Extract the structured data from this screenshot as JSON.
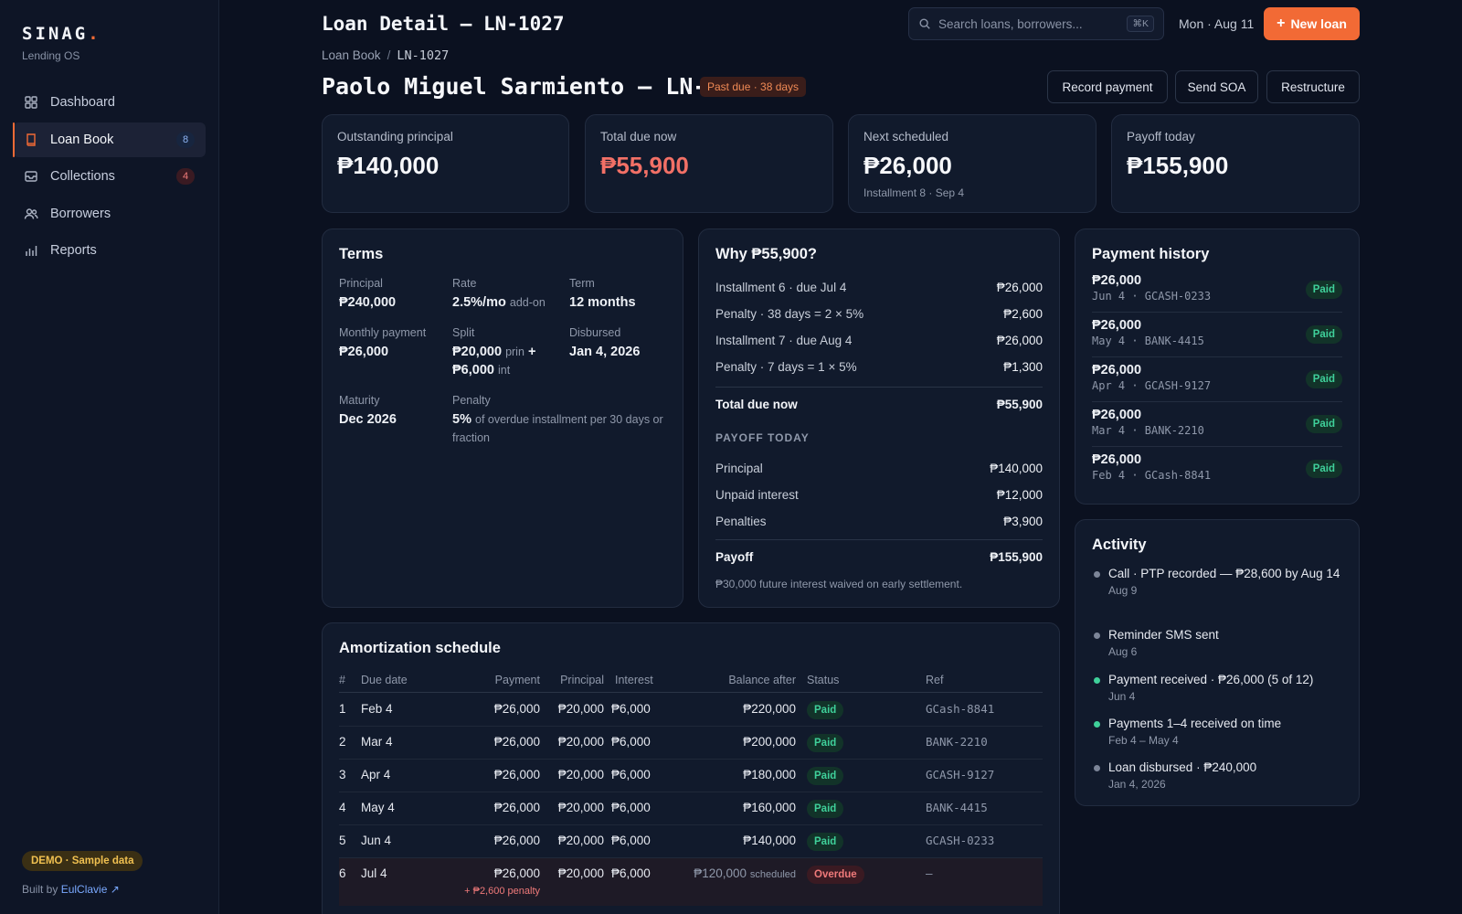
{
  "brand": {
    "name": "SINAG",
    "dot": ".",
    "sub": "Lending OS"
  },
  "nav": [
    {
      "label": "Dashboard",
      "icon": "grid-icon",
      "badge": ""
    },
    {
      "label": "Loan Book",
      "icon": "book-icon",
      "badge": "8"
    },
    {
      "label": "Collections",
      "icon": "inbox-icon",
      "badge": "4"
    },
    {
      "label": "Borrowers",
      "icon": "users-icon",
      "badge": ""
    },
    {
      "label": "Reports",
      "icon": "bar-chart-icon",
      "badge": ""
    }
  ],
  "footer": {
    "demo": "DEMO · Sample data",
    "built_by": "Built by",
    "author": "EulClavie ↗"
  },
  "header": {
    "title": "Loan Detail — LN-1027",
    "search_placeholder": "Search loans, borrowers...",
    "search_kbd": "⌘K",
    "date": "Mon · Aug 11",
    "new_loan": "New loan",
    "new_loan_plus": "+"
  },
  "breadcrumb": {
    "root": "Loan Book",
    "sep": "/",
    "current": "LN-1027"
  },
  "loan": {
    "title": "Paolo Miguel Sarmiento — LN-1027",
    "status": "Past due · 38 days",
    "actions": [
      "Record payment",
      "Send SOA",
      "Restructure"
    ]
  },
  "kpis": [
    {
      "label": "Outstanding principal",
      "value": "₱140,000",
      "sub": ""
    },
    {
      "label": "Total due now",
      "value": "₱55,900",
      "sub": ""
    },
    {
      "label": "Next scheduled",
      "value": "₱26,000",
      "sub": "Installment 8 · Sep 4"
    },
    {
      "label": "Payoff today",
      "value": "₱155,900",
      "sub": ""
    }
  ],
  "terms": {
    "title": "Terms",
    "principal_label": "Principal",
    "principal": "₱240,000",
    "rate_label": "Rate",
    "rate": "2.5%/mo",
    "rate_note": "add-on",
    "term_label": "Term",
    "term": "12 months",
    "monthly_label": "Monthly payment",
    "monthly": "₱26,000",
    "split_label": "Split",
    "split_prin": "₱20,000",
    "split_prin_note": "prin",
    "split_plus": "+",
    "split_int": "₱6,000",
    "split_int_note": "int",
    "disbursed_label": "Disbursed",
    "disbursed": "Jan 4, 2026",
    "maturity_label": "Maturity",
    "maturity": "Dec 2026",
    "penalty_label": "Penalty",
    "penalty": "5%",
    "penalty_note": "of overdue installment per 30 days or fraction"
  },
  "why": {
    "title": "Why ₱55,900?",
    "rows": [
      {
        "label": "Installment 6 · due Jul 4",
        "amount": "₱26,000"
      },
      {
        "label": "Penalty · 38 days = 2 × 5%",
        "amount": "₱2,600"
      },
      {
        "label": "Installment 7 · due Aug 4",
        "amount": "₱26,000"
      },
      {
        "label": "Penalty · 7 days = 1 × 5%",
        "amount": "₱1,300"
      }
    ],
    "total_label": "Total due now",
    "total": "₱55,900",
    "payoff_section": "PAYOFF TODAY",
    "payoff_rows": [
      {
        "label": "Principal",
        "amount": "₱140,000"
      },
      {
        "label": "Unpaid interest",
        "amount": "₱12,000"
      },
      {
        "label": "Penalties",
        "amount": "₱3,900"
      }
    ],
    "payoff_label": "Payoff",
    "payoff": "₱155,900",
    "note": "₱30,000 future interest waived on early settlement."
  },
  "history": {
    "title": "Payment history",
    "items": [
      {
        "amount": "₱26,000",
        "meta": "Jun 4 · GCASH-0233",
        "status": "Paid"
      },
      {
        "amount": "₱26,000",
        "meta": "May 4 · BANK-4415",
        "status": "Paid"
      },
      {
        "amount": "₱26,000",
        "meta": "Apr 4 · GCASH-9127",
        "status": "Paid"
      },
      {
        "amount": "₱26,000",
        "meta": "Mar 4 · BANK-2210",
        "status": "Paid"
      },
      {
        "amount": "₱26,000",
        "meta": "Feb 4 · GCash-8841",
        "status": "Paid"
      }
    ]
  },
  "activity": {
    "title": "Activity",
    "items": [
      {
        "text": "Call · PTP recorded — ₱28,600 by Aug 14",
        "date": "Aug 9",
        "dot": "#7c8598"
      },
      {
        "text": "Reminder SMS sent",
        "date": "Aug 6",
        "dot": "#7c8598"
      },
      {
        "text": "Payment received · ₱26,000 (5 of 12)",
        "date": "Jun 4",
        "dot": "#3fd09a"
      },
      {
        "text": "Payments 1–4 received on time",
        "date": "Feb 4 – May 4",
        "dot": "#3fd09a"
      },
      {
        "text": "Loan disbursed · ₱240,000",
        "date": "Jan 4, 2026",
        "dot": "#7c8598"
      }
    ]
  },
  "amort": {
    "title": "Amortization schedule",
    "headers": [
      "#",
      "Due date",
      "Payment",
      "Principal",
      "Interest",
      "Balance after",
      "Status",
      "Ref"
    ],
    "rows": [
      {
        "n": "1",
        "due": "Feb 4",
        "payment": "₱26,000",
        "principal": "₱20,000",
        "interest": "₱6,000",
        "balance": "₱220,000",
        "status": "Paid",
        "ref": "GCash-8841"
      },
      {
        "n": "2",
        "due": "Mar 4",
        "payment": "₱26,000",
        "principal": "₱20,000",
        "interest": "₱6,000",
        "balance": "₱200,000",
        "status": "Paid",
        "ref": "BANK-2210"
      },
      {
        "n": "3",
        "due": "Apr 4",
        "payment": "₱26,000",
        "principal": "₱20,000",
        "interest": "₱6,000",
        "balance": "₱180,000",
        "status": "Paid",
        "ref": "GCASH-9127"
      },
      {
        "n": "4",
        "due": "May 4",
        "payment": "₱26,000",
        "principal": "₱20,000",
        "interest": "₱6,000",
        "balance": "₱160,000",
        "status": "Paid",
        "ref": "BANK-4415"
      },
      {
        "n": "5",
        "due": "Jun 4",
        "payment": "₱26,000",
        "principal": "₱20,000",
        "interest": "₱6,000",
        "balance": "₱140,000",
        "status": "Paid",
        "ref": "GCASH-0233"
      }
    ],
    "overdue_row": {
      "n": "6",
      "due": "Jul 4",
      "payment": "₱26,000",
      "principal": "₱20,000",
      "interest": "₱6,000",
      "balance": "₱120,000",
      "balance_note": "scheduled",
      "status": "Overdue",
      "ref": "—",
      "penalty_note": "+ ₱2,600 penalty"
    }
  },
  "colors": {
    "accent": "#f26a35",
    "paid": "#3fd09a",
    "overdue": "#f07a7a",
    "background": "#0b1120"
  }
}
